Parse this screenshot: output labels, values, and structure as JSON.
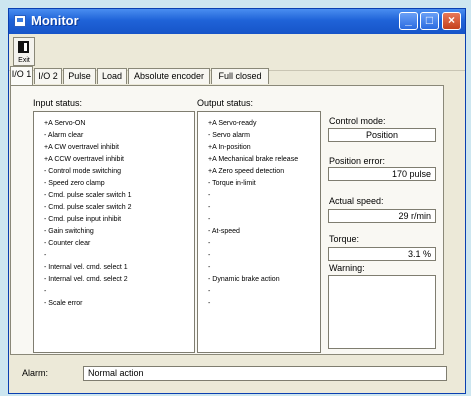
{
  "window": {
    "title": "Monitor",
    "title_icon": "app-window-icon",
    "controls": [
      "minimize-icon",
      "maximize-icon",
      "close-icon"
    ]
  },
  "toolbar": {
    "exit_label": "Exit",
    "exit_icon": "exit-door-icon"
  },
  "tabs": [
    {
      "label": "I/O 1",
      "active": true
    },
    {
      "label": "I/O 2",
      "active": false
    },
    {
      "label": "Pulse",
      "active": false
    },
    {
      "label": "Load",
      "active": false
    },
    {
      "label": "Absolute encoder",
      "active": false
    },
    {
      "label": "Full closed",
      "active": false
    }
  ],
  "input_status": {
    "label": "Input status:",
    "items": [
      "+A Servo-ON",
      "-   Alarm clear",
      "+A CW overtravel inhibit",
      "+A CCW overtravel inhibit",
      "-   Control mode switching",
      "-   Speed zero clamp",
      "-   Cmd. pulse scaler switch 1",
      "-   Cmd. pulse scaler switch 2",
      "-   Cmd. pulse input inhibit",
      "-   Gain switching",
      "-   Counter clear",
      "-",
      "-   Internal vel. cmd. select 1",
      "-   Internal vel. cmd. select 2",
      "-",
      "-   Scale error"
    ]
  },
  "output_status": {
    "label": "Output status:",
    "items": [
      "+A Servo-ready",
      "-   Servo alarm",
      "+A In-position",
      "+A Mechanical brake release",
      "+A Zero speed detection",
      "-   Torque in-limit",
      "-",
      "-",
      "-",
      "-   At-speed",
      "-",
      "-",
      "-",
      "-   Dynamic brake action",
      "-",
      "-"
    ]
  },
  "monitor": {
    "control_mode": {
      "label": "Control mode:",
      "value": "Position"
    },
    "position_error": {
      "label": "Position error:",
      "value": "170 pulse"
    },
    "actual_speed": {
      "label": "Actual speed:",
      "value": "29 r/min"
    },
    "torque": {
      "label": "Torque:",
      "value": "3.1 %"
    },
    "warning": {
      "label": "Warning:",
      "value": ""
    }
  },
  "alarm": {
    "label": "Alarm:",
    "value": "Normal action"
  },
  "colors": {
    "titlebar": "#1f63d8",
    "window_bg": "#ece9d8",
    "close_button": "#c5401c",
    "desktop": "#cde6f0"
  }
}
